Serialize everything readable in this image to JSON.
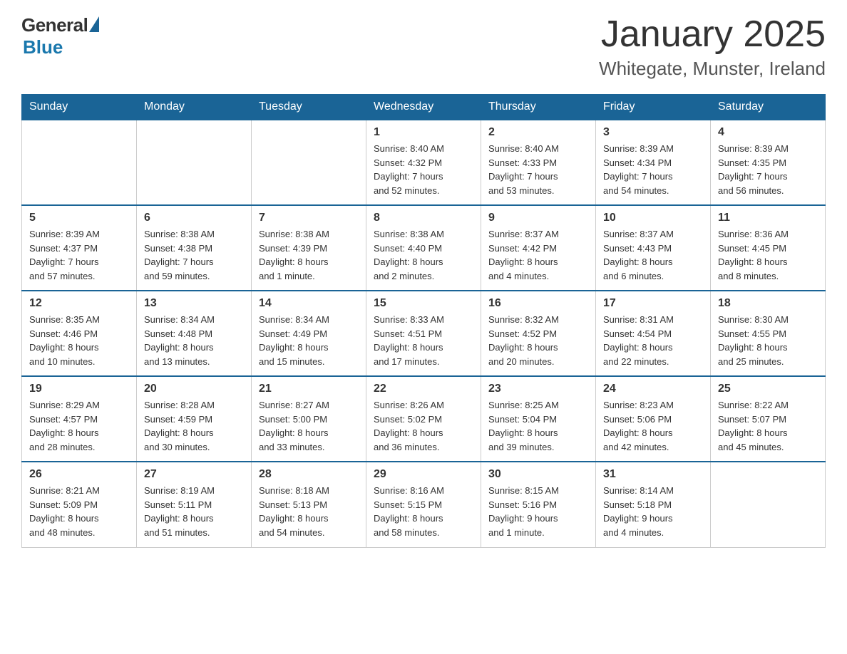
{
  "logo": {
    "general": "General",
    "blue": "Blue"
  },
  "title": "January 2025",
  "subtitle": "Whitegate, Munster, Ireland",
  "days_of_week": [
    "Sunday",
    "Monday",
    "Tuesday",
    "Wednesday",
    "Thursday",
    "Friday",
    "Saturday"
  ],
  "weeks": [
    [
      {
        "day": "",
        "info": ""
      },
      {
        "day": "",
        "info": ""
      },
      {
        "day": "",
        "info": ""
      },
      {
        "day": "1",
        "info": "Sunrise: 8:40 AM\nSunset: 4:32 PM\nDaylight: 7 hours\nand 52 minutes."
      },
      {
        "day": "2",
        "info": "Sunrise: 8:40 AM\nSunset: 4:33 PM\nDaylight: 7 hours\nand 53 minutes."
      },
      {
        "day": "3",
        "info": "Sunrise: 8:39 AM\nSunset: 4:34 PM\nDaylight: 7 hours\nand 54 minutes."
      },
      {
        "day": "4",
        "info": "Sunrise: 8:39 AM\nSunset: 4:35 PM\nDaylight: 7 hours\nand 56 minutes."
      }
    ],
    [
      {
        "day": "5",
        "info": "Sunrise: 8:39 AM\nSunset: 4:37 PM\nDaylight: 7 hours\nand 57 minutes."
      },
      {
        "day": "6",
        "info": "Sunrise: 8:38 AM\nSunset: 4:38 PM\nDaylight: 7 hours\nand 59 minutes."
      },
      {
        "day": "7",
        "info": "Sunrise: 8:38 AM\nSunset: 4:39 PM\nDaylight: 8 hours\nand 1 minute."
      },
      {
        "day": "8",
        "info": "Sunrise: 8:38 AM\nSunset: 4:40 PM\nDaylight: 8 hours\nand 2 minutes."
      },
      {
        "day": "9",
        "info": "Sunrise: 8:37 AM\nSunset: 4:42 PM\nDaylight: 8 hours\nand 4 minutes."
      },
      {
        "day": "10",
        "info": "Sunrise: 8:37 AM\nSunset: 4:43 PM\nDaylight: 8 hours\nand 6 minutes."
      },
      {
        "day": "11",
        "info": "Sunrise: 8:36 AM\nSunset: 4:45 PM\nDaylight: 8 hours\nand 8 minutes."
      }
    ],
    [
      {
        "day": "12",
        "info": "Sunrise: 8:35 AM\nSunset: 4:46 PM\nDaylight: 8 hours\nand 10 minutes."
      },
      {
        "day": "13",
        "info": "Sunrise: 8:34 AM\nSunset: 4:48 PM\nDaylight: 8 hours\nand 13 minutes."
      },
      {
        "day": "14",
        "info": "Sunrise: 8:34 AM\nSunset: 4:49 PM\nDaylight: 8 hours\nand 15 minutes."
      },
      {
        "day": "15",
        "info": "Sunrise: 8:33 AM\nSunset: 4:51 PM\nDaylight: 8 hours\nand 17 minutes."
      },
      {
        "day": "16",
        "info": "Sunrise: 8:32 AM\nSunset: 4:52 PM\nDaylight: 8 hours\nand 20 minutes."
      },
      {
        "day": "17",
        "info": "Sunrise: 8:31 AM\nSunset: 4:54 PM\nDaylight: 8 hours\nand 22 minutes."
      },
      {
        "day": "18",
        "info": "Sunrise: 8:30 AM\nSunset: 4:55 PM\nDaylight: 8 hours\nand 25 minutes."
      }
    ],
    [
      {
        "day": "19",
        "info": "Sunrise: 8:29 AM\nSunset: 4:57 PM\nDaylight: 8 hours\nand 28 minutes."
      },
      {
        "day": "20",
        "info": "Sunrise: 8:28 AM\nSunset: 4:59 PM\nDaylight: 8 hours\nand 30 minutes."
      },
      {
        "day": "21",
        "info": "Sunrise: 8:27 AM\nSunset: 5:00 PM\nDaylight: 8 hours\nand 33 minutes."
      },
      {
        "day": "22",
        "info": "Sunrise: 8:26 AM\nSunset: 5:02 PM\nDaylight: 8 hours\nand 36 minutes."
      },
      {
        "day": "23",
        "info": "Sunrise: 8:25 AM\nSunset: 5:04 PM\nDaylight: 8 hours\nand 39 minutes."
      },
      {
        "day": "24",
        "info": "Sunrise: 8:23 AM\nSunset: 5:06 PM\nDaylight: 8 hours\nand 42 minutes."
      },
      {
        "day": "25",
        "info": "Sunrise: 8:22 AM\nSunset: 5:07 PM\nDaylight: 8 hours\nand 45 minutes."
      }
    ],
    [
      {
        "day": "26",
        "info": "Sunrise: 8:21 AM\nSunset: 5:09 PM\nDaylight: 8 hours\nand 48 minutes."
      },
      {
        "day": "27",
        "info": "Sunrise: 8:19 AM\nSunset: 5:11 PM\nDaylight: 8 hours\nand 51 minutes."
      },
      {
        "day": "28",
        "info": "Sunrise: 8:18 AM\nSunset: 5:13 PM\nDaylight: 8 hours\nand 54 minutes."
      },
      {
        "day": "29",
        "info": "Sunrise: 8:16 AM\nSunset: 5:15 PM\nDaylight: 8 hours\nand 58 minutes."
      },
      {
        "day": "30",
        "info": "Sunrise: 8:15 AM\nSunset: 5:16 PM\nDaylight: 9 hours\nand 1 minute."
      },
      {
        "day": "31",
        "info": "Sunrise: 8:14 AM\nSunset: 5:18 PM\nDaylight: 9 hours\nand 4 minutes."
      },
      {
        "day": "",
        "info": ""
      }
    ]
  ]
}
